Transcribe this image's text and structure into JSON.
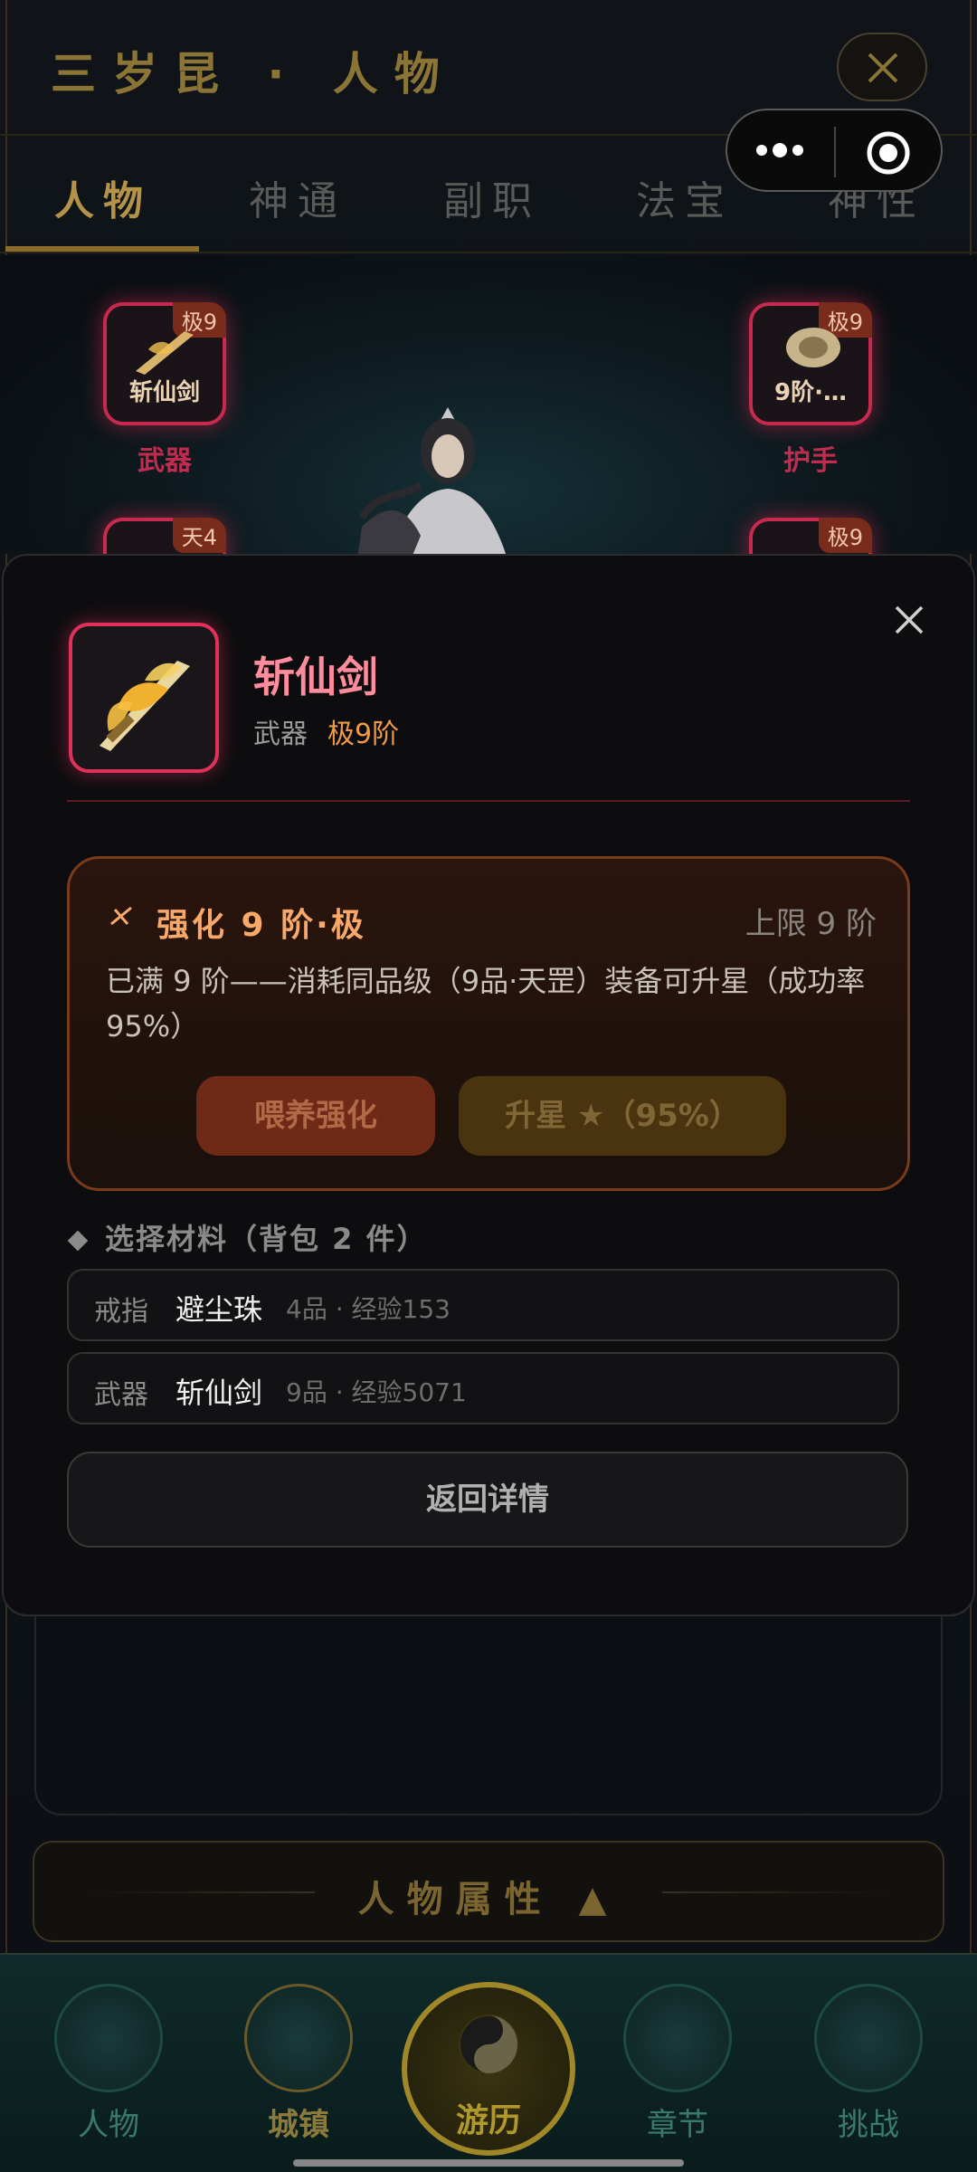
{
  "app": {
    "title": "三岁昆 · 人物"
  },
  "tabs": [
    {
      "label": "人物"
    },
    {
      "label": "神通"
    },
    {
      "label": "副职"
    },
    {
      "label": "法宝"
    },
    {
      "label": "神性"
    }
  ],
  "equipment_slots": [
    {
      "badge": "极9",
      "name": "斩仙剑",
      "label": "武器"
    },
    {
      "badge": "极9",
      "name": "9阶·…",
      "label": "护手"
    },
    {
      "badge": "天4"
    },
    {
      "badge": "极9"
    }
  ],
  "modal": {
    "item_name": "斩仙剑",
    "item_type": "武器",
    "item_grade": "极9阶",
    "enhance": {
      "title": "强化 9 阶·极",
      "limit": "上限 9 阶",
      "description": "已满 9 阶——消耗同品级（9品·天罡）装备可升星（成功率 95%）",
      "feed_button": "喂养强化",
      "star_button": "升星 ★（95%）"
    },
    "materials_heading": "选择材料（背包 2 件）",
    "materials": [
      {
        "type": "戒指",
        "name": "避尘珠",
        "info": "4品 · 经验153"
      },
      {
        "type": "武器",
        "name": "斩仙剑",
        "info": "9品 · 经验5071"
      }
    ],
    "back_button": "返回详情"
  },
  "attributes_bar": {
    "label": "人物属性 ▲"
  },
  "nav": [
    {
      "label": "人物",
      "icon": "character-icon"
    },
    {
      "label": "城镇",
      "icon": "town-icon"
    },
    {
      "label": "游历",
      "icon": "yin-yang-icon"
    },
    {
      "label": "章节",
      "icon": "scroll-icon"
    },
    {
      "label": "挑战",
      "icon": "sword-icon"
    }
  ],
  "colors": {
    "accent_gold": "#b49348",
    "rarity_red": "#e0315a",
    "enhance_orange": "#f8a868"
  }
}
